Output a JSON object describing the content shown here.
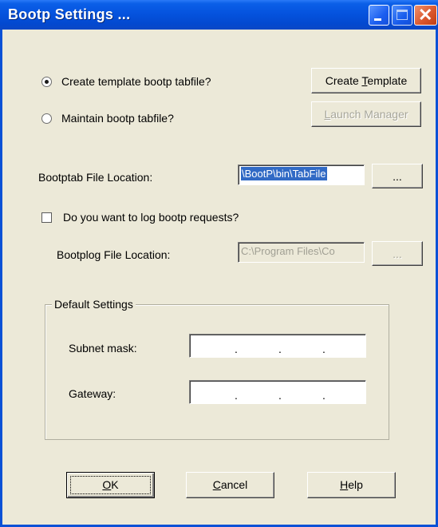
{
  "window": {
    "title": "Bootp Settings ...",
    "controls": [
      "minimize-icon",
      "maximize-icon",
      "close-icon"
    ]
  },
  "options": {
    "create_template_label": "Create template bootp tabfile?",
    "create_template_selected": true,
    "maintain_label": "Maintain bootp tabfile?",
    "maintain_selected": false
  },
  "buttons": {
    "create_template": {
      "pre": "Create ",
      "ul": "T",
      "post": "emplate"
    },
    "launch_manager": {
      "pre": "",
      "ul": "L",
      "post": "aunch Manager"
    },
    "browse_tab": "...",
    "browse_log": "...",
    "ok": {
      "pre": "",
      "ul": "O",
      "post": "K"
    },
    "cancel": {
      "pre": "",
      "ul": "C",
      "post": "ancel"
    },
    "help": {
      "pre": "",
      "ul": "H",
      "post": "elp"
    }
  },
  "bootptab": {
    "label": "Bootptab File Location:",
    "value": "\\BootP\\bin\\TabFile"
  },
  "logging": {
    "checkbox_label": "Do you want to log bootp requests?",
    "checked": false,
    "bootplog_label": "Bootplog File Location:",
    "bootplog_value": "C:\\Program Files\\Co"
  },
  "defaults": {
    "legend": "Default Settings",
    "subnet_label": "Subnet mask:",
    "gateway_label": "Gateway:",
    "ip_separator": "."
  }
}
